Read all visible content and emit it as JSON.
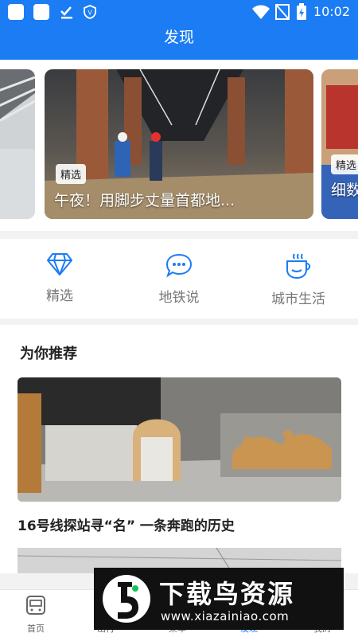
{
  "status_bar": {
    "time": "10:02"
  },
  "header": {
    "title": "发现"
  },
  "carousel": {
    "slides": [
      {
        "tag": "",
        "caption": ""
      },
      {
        "tag": "精选",
        "caption": "午夜！用脚步丈量首都地..."
      },
      {
        "tag": "精选",
        "caption": "细数"
      }
    ]
  },
  "categories": [
    {
      "label": "精选",
      "icon": "diamond-icon"
    },
    {
      "label": "地铁说",
      "icon": "chat-bubble-icon"
    },
    {
      "label": "城市生活",
      "icon": "coffee-cup-icon"
    }
  ],
  "recommend": {
    "title": "为你推荐",
    "articles": [
      {
        "title": "16号线探站寻“名” 一条奔跑的历史"
      }
    ]
  },
  "bottom_nav": [
    {
      "label": "首页",
      "icon": "home-icon",
      "active": false
    },
    {
      "label": "出行",
      "icon": "travel-icon",
      "active": false
    },
    {
      "label": "乘车",
      "icon": "ride-icon",
      "active": false
    },
    {
      "label": "发现",
      "icon": "discover-icon",
      "active": true
    },
    {
      "label": "我的",
      "icon": "profile-icon",
      "active": false
    }
  ],
  "watermark": {
    "text": "下载鸟资源",
    "url": "www.xiazainiao.com"
  },
  "colors": {
    "primary": "#1b7cf4",
    "background": "#f2f2f2"
  }
}
